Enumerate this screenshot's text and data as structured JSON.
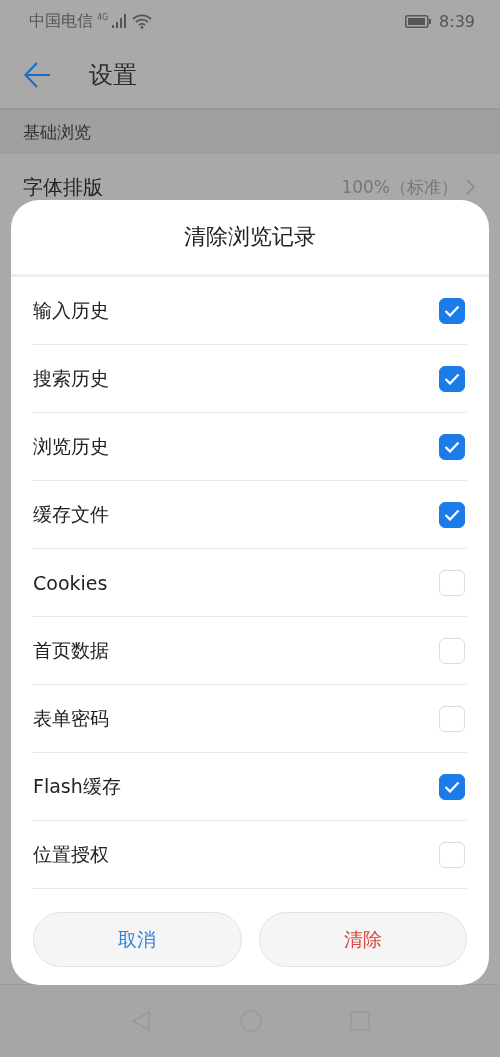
{
  "status_bar": {
    "carrier": "中国电信",
    "network": "4G",
    "time": "8:39"
  },
  "header": {
    "title": "设置"
  },
  "section": {
    "title": "基础浏览"
  },
  "setting_row": {
    "label": "字体排版",
    "value": "100%（标准）"
  },
  "dialog": {
    "title": "清除浏览记录",
    "options": [
      {
        "label": "输入历史",
        "checked": true
      },
      {
        "label": "搜索历史",
        "checked": true
      },
      {
        "label": "浏览历史",
        "checked": true
      },
      {
        "label": "缓存文件",
        "checked": true
      },
      {
        "label": "Cookies",
        "checked": false
      },
      {
        "label": "首页数据",
        "checked": false
      },
      {
        "label": "表单密码",
        "checked": false
      },
      {
        "label": "Flash缓存",
        "checked": true
      },
      {
        "label": "位置授权",
        "checked": false
      }
    ],
    "buttons": [
      {
        "label": "取消",
        "kind": "cancel"
      },
      {
        "label": "清除",
        "kind": "destructive"
      }
    ]
  }
}
